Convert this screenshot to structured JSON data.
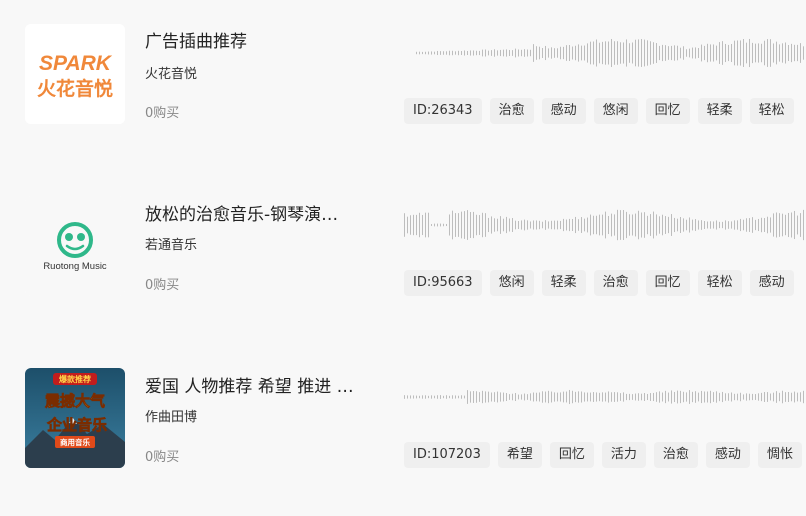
{
  "tracks": [
    {
      "title": "广告插曲推荐",
      "author": "火花音悦",
      "buys": "0购买",
      "cover": {
        "line1": "SPARK",
        "line2": "火花音悦",
        "accent": "#f0883a"
      },
      "tags": [
        "ID:26343",
        "治愈",
        "感动",
        "悠闲",
        "回忆",
        "轻柔",
        "轻松"
      ]
    },
    {
      "title": "放松的治愈音乐-钢琴演…",
      "author": "若通音乐",
      "buys": "0购买",
      "cover": {
        "brand": "Ruotong Music",
        "accent": "#2fb88a"
      },
      "tags": [
        "ID:95663",
        "悠闲",
        "轻柔",
        "治愈",
        "回忆",
        "轻松",
        "感动"
      ]
    },
    {
      "title": "爱国 人物推荐 希望 推进 …",
      "author": "作曲田博",
      "buys": "0购买",
      "cover": {
        "badge": "爆款推荐",
        "line1": "震撼大气",
        "line2": "企业音乐",
        "line3": "商用音乐",
        "accent": "#f5d21f"
      },
      "tags": [
        "ID:107203",
        "希望",
        "回忆",
        "活力",
        "治愈",
        "感动",
        "惆怅"
      ]
    }
  ]
}
